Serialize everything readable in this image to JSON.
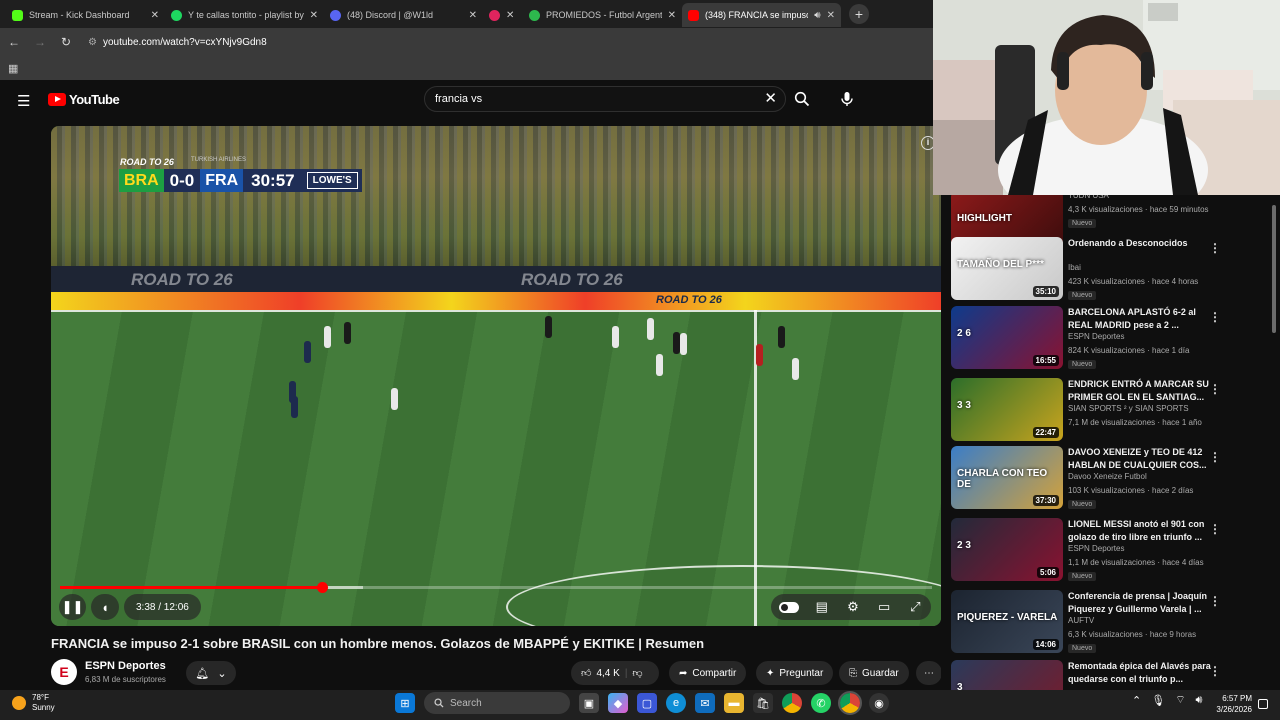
{
  "browser": {
    "tabs": [
      {
        "title": "Stream - Kick Dashboard",
        "color": "#53fc18"
      },
      {
        "title": "Y te callas tontito - playlist by J",
        "color": "#1ed760"
      },
      {
        "title": "(48) Discord | @W1ld",
        "color": "#5865f2"
      },
      {
        "title": "",
        "color": "#e0245e"
      },
      {
        "title": "PROMIEDOS - Futbol Argentino",
        "color": "#2db84d"
      },
      {
        "title": "(348) FRANCIA se impuso 2",
        "color": "#ff0000"
      }
    ],
    "url": "youtube.com/watch?v=cxYNjv9Gdn8"
  },
  "youtube": {
    "logo": "YouTube",
    "search_query": "francia vs"
  },
  "video": {
    "scoreboard": {
      "brand": "ROAD TO 26",
      "sponsor": "TURKISH AIRLINES",
      "team_home": "BRA",
      "score": "0-0",
      "team_away": "FRA",
      "clock": "30:57",
      "ad": "LOWE'S"
    },
    "ad_boards": [
      "ROAD TO 26",
      "ROAD TO 26",
      "ROAD TO 26"
    ],
    "time_display": "3:38 / 12:06",
    "progress": 0.3,
    "buffered": 0.347,
    "title": "FRANCIA se impuso 2-1 sobre BRASIL con un hombre menos. Golazos de MBAPPÉ y EKITIKE | Resumen"
  },
  "channel": {
    "name": "ESPN Deportes",
    "subscribers": "6,83 M de suscriptores",
    "avatar_letter": "E"
  },
  "actions": {
    "likes": "4,4 K",
    "share": "Compartir",
    "ask": "Preguntar",
    "save": "Guardar"
  },
  "recommendations": [
    {
      "title": "",
      "channel": "TUDN USA",
      "views": "4,3 K visualizaciones · hace 59 minutos",
      "badge": "Nuevo",
      "duration": "14:21",
      "thumb_text": "HIGHLIGHT",
      "c1": "#8d1a1a",
      "c2": "#3a0c0c"
    },
    {
      "title": "Ordenando a Desconocidos",
      "channel": "Ibai",
      "views": "423 K visualizaciones · hace 4 horas",
      "badge": "Nuevo",
      "duration": "35:10",
      "thumb_text": "TAMAÑO DEL P***",
      "c1": "#f2f2f2",
      "c2": "#c8c8c8"
    },
    {
      "title": "BARCELONA APLASTÓ 6-2 al REAL MADRID pese a 2 ...",
      "channel": "ESPN Deportes",
      "views": "824 K visualizaciones · hace 1 día",
      "badge": "Nuevo",
      "duration": "16:55",
      "thumb_text": "2 6",
      "c1": "#0d3b8c",
      "c2": "#8a1230"
    },
    {
      "title": "ENDRICK ENTRÓ A MARCAR SU PRIMER GOL EN EL SANTIAG...",
      "channel": "SIAN SPORTS ² y SIAN SPORTS",
      "views": "7,1 M de visualizaciones · hace 1 año",
      "badge": "",
      "duration": "22:47",
      "thumb_text": "3 3",
      "c1": "#2c6e2a",
      "c2": "#c9a41e"
    },
    {
      "title": "DAVOO XENEIZE y TEO DE 412 HABLAN DE CUALQUIER COS...",
      "channel": "Davoo Xeneize Futbol",
      "views": "103 K visualizaciones · hace 2 días",
      "badge": "Nuevo",
      "duration": "37:30",
      "thumb_text": "CHARLA CON TEO DE",
      "c1": "#3a7dc8",
      "c2": "#d4a23a"
    },
    {
      "title": "LIONEL MESSI anotó el 901 con golazo de tiro libre en triunfo ...",
      "channel": "ESPN Deportes",
      "views": "1,1 M de visualizaciones · hace 4 días",
      "badge": "Nuevo",
      "duration": "5:06",
      "thumb_text": "2 3",
      "c1": "#222a3a",
      "c2": "#8a1230"
    },
    {
      "title": "Conferencia de prensa | Joaquín Piquerez y Guillermo Varela | ...",
      "channel": "AUFTV",
      "views": "6,3 K visualizaciones · hace 9 horas",
      "badge": "Nuevo",
      "duration": "14:06",
      "thumb_text": "PIQUEREZ - VARELA",
      "c1": "#1c2430",
      "c2": "#3a4658"
    },
    {
      "title": "Remontada épica del Alavés para quedarse con el triunfo p...",
      "channel": "",
      "views": "",
      "badge": "",
      "duration": "",
      "thumb_text": "3",
      "c1": "#2a3a5a",
      "c2": "#7a1a2a"
    }
  ],
  "taskbar": {
    "temp": "78°F",
    "condition": "Sunny",
    "search_placeholder": "Search",
    "time": "6:57 PM",
    "date": "3/26/2026"
  }
}
